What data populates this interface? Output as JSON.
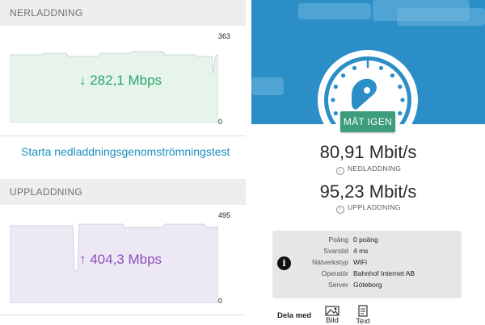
{
  "download": {
    "header": "NERLADDNING",
    "speed": "↓ 282,1 Mbps",
    "max": "363",
    "min": "0",
    "fill_color": "#e6f4ec",
    "line_color": "#c9d8cf",
    "text_color": "#2aa668"
  },
  "test_link": "Starta nedladdningsgenomströmningstest",
  "upload": {
    "header": "UPPLADDNING",
    "speed": "↑ 404,3 Mbps",
    "max": "495",
    "min": "0",
    "fill_color": "#ede9f4",
    "line_color": "#d4cfe0",
    "text_color": "#8a4cc0"
  },
  "speedtest": {
    "button_label": "MÄT IGEN",
    "download_value": "80,91 Mbit/s",
    "download_label": "NEDLADDNING",
    "upload_value": "95,23 Mbit/s",
    "upload_label": "UPPLADDNING",
    "accent_color": "#2b8ec6",
    "button_color": "#3c9c7c"
  },
  "info": {
    "rows": [
      {
        "key": "Poäng",
        "value": "0 poäng"
      },
      {
        "key": "Svarstid",
        "value": "4 ms"
      },
      {
        "key": "Nätverkstyp",
        "value": "WiFi"
      },
      {
        "key": "Operatör",
        "value": "Bahnhof Internet AB"
      },
      {
        "key": "Server",
        "value": "Göteborg"
      }
    ]
  },
  "share": {
    "label": "Dela med",
    "items": [
      {
        "label": "Bild",
        "icon": "image-icon"
      },
      {
        "label": "Text",
        "icon": "document-icon"
      }
    ]
  }
}
